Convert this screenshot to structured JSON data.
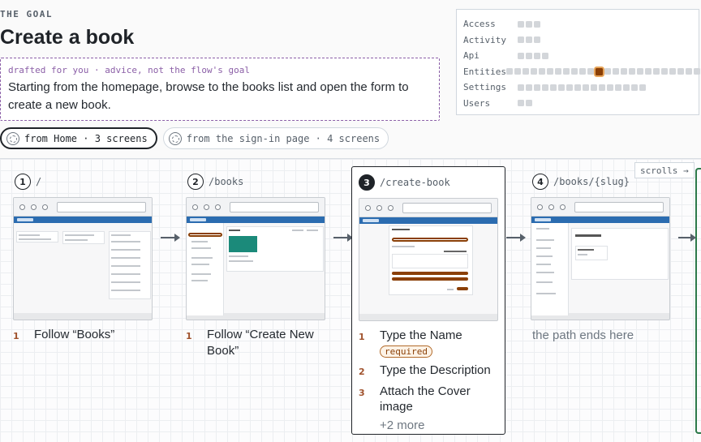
{
  "goal": {
    "eyebrow": "THE GOAL",
    "title": "Create a book",
    "draft_tag": "drafted for you · advice, not the flow's goal",
    "draft_text": "Starting from the homepage, browse to the books list and open the form to create a new book."
  },
  "routes": [
    {
      "label": "from Home · 3 screens",
      "active": true
    },
    {
      "label": "from the sign-in page · 4 screens",
      "active": false
    }
  ],
  "heatmap": {
    "rows": [
      {
        "label": "Access",
        "cells": 3,
        "hot": -1
      },
      {
        "label": "Activity",
        "cells": 3,
        "hot": -1
      },
      {
        "label": "Api",
        "cells": 4,
        "hot": -1
      },
      {
        "label": "Entities",
        "cells": 24,
        "hot": 11
      },
      {
        "label": "Settings",
        "cells": 16,
        "hot": -1
      },
      {
        "label": "Users",
        "cells": 2,
        "hot": -1
      }
    ]
  },
  "flow": {
    "scroll_hint": "scrolls →",
    "steps": [
      {
        "num": "1",
        "path": "/",
        "actions": [
          {
            "n": "1",
            "text": "Follow “Books”"
          }
        ]
      },
      {
        "num": "2",
        "path": "/books",
        "actions": [
          {
            "n": "1",
            "text": "Follow “Create New Book”"
          }
        ]
      },
      {
        "num": "3",
        "path": "/create-book",
        "actions": [
          {
            "n": "1",
            "text": "Type the Name",
            "badge": "required"
          },
          {
            "n": "2",
            "text": "Type the Description"
          },
          {
            "n": "3",
            "text": "Attach the Cover image"
          }
        ],
        "more": "+2 more"
      },
      {
        "num": "4",
        "path": "/books/{slug}",
        "end_text": "the path ends here"
      }
    ]
  }
}
